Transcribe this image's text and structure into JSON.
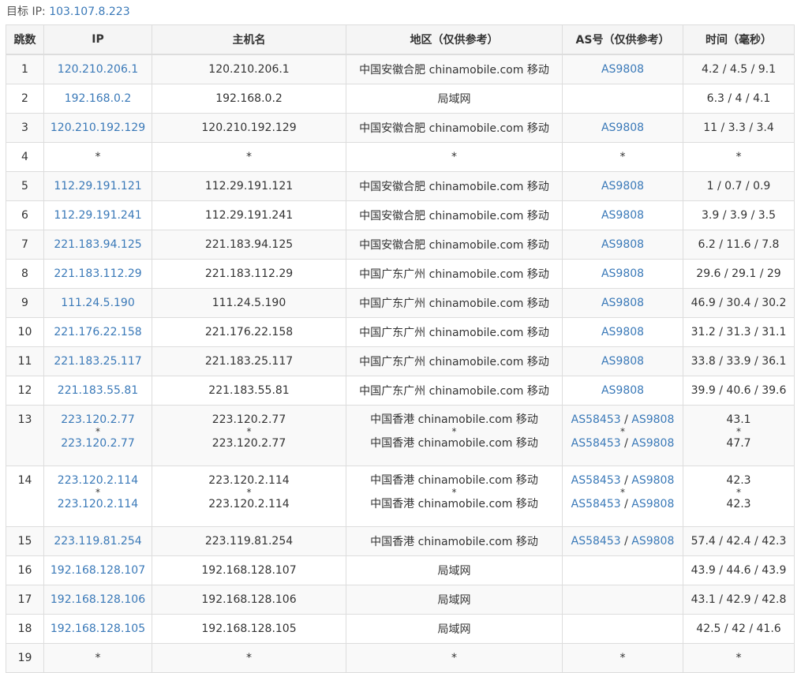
{
  "target": {
    "label": "目标 IP:",
    "ip": "103.107.8.223"
  },
  "headers": [
    "跳数",
    "IP",
    "主机名",
    "地区（仅供参考）",
    "AS号（仅供参考）",
    "时间（毫秒）"
  ],
  "rows": [
    {
      "hop": "1",
      "ip": "120.210.206.1",
      "host": "120.210.206.1",
      "region": "中国安徽合肥 chinamobile.com 移动",
      "as": "AS9808",
      "time": "4.2 / 4.5 / 9.1"
    },
    {
      "hop": "2",
      "ip": "192.168.0.2",
      "host": "192.168.0.2",
      "region": "局域网",
      "as": "",
      "time": "6.3 / 4 / 4.1"
    },
    {
      "hop": "3",
      "ip": "120.210.192.129",
      "host": "120.210.192.129",
      "region": "中国安徽合肥 chinamobile.com 移动",
      "as": "AS9808",
      "time": "11 / 3.3 / 3.4"
    },
    {
      "hop": "4",
      "ip": "*",
      "host": "*",
      "region": "*",
      "as": "*",
      "time": "*"
    },
    {
      "hop": "5",
      "ip": "112.29.191.121",
      "host": "112.29.191.121",
      "region": "中国安徽合肥 chinamobile.com 移动",
      "as": "AS9808",
      "time": "1 / 0.7 / 0.9"
    },
    {
      "hop": "6",
      "ip": "112.29.191.241",
      "host": "112.29.191.241",
      "region": "中国安徽合肥 chinamobile.com 移动",
      "as": "AS9808",
      "time": "3.9 / 3.9 / 3.5"
    },
    {
      "hop": "7",
      "ip": "221.183.94.125",
      "host": "221.183.94.125",
      "region": "中国安徽合肥 chinamobile.com 移动",
      "as": "AS9808",
      "time": "6.2 / 11.6 / 7.8"
    },
    {
      "hop": "8",
      "ip": "221.183.112.29",
      "host": "221.183.112.29",
      "region": "中国广东广州 chinamobile.com 移动",
      "as": "AS9808",
      "time": "29.6 / 29.1 / 29"
    },
    {
      "hop": "9",
      "ip": "111.24.5.190",
      "host": "111.24.5.190",
      "region": "中国广东广州 chinamobile.com 移动",
      "as": "AS9808",
      "time": "46.9 / 30.4 / 30.2"
    },
    {
      "hop": "10",
      "ip": "221.176.22.158",
      "host": "221.176.22.158",
      "region": "中国广东广州 chinamobile.com 移动",
      "as": "AS9808",
      "time": "31.2 / 31.3 / 31.1"
    },
    {
      "hop": "11",
      "ip": "221.183.25.117",
      "host": "221.183.25.117",
      "region": "中国广东广州 chinamobile.com 移动",
      "as": "AS9808",
      "time": "33.8 / 33.9 / 36.1"
    },
    {
      "hop": "12",
      "ip": "221.183.55.81",
      "host": "221.183.55.81",
      "region": "中国广东广州 chinamobile.com 移动",
      "as": "AS9808",
      "time": "39.9 / 40.6 / 39.6"
    },
    {
      "hop": "13",
      "ip": "223.120.2.77",
      "host": "223.120.2.77",
      "region": "中国香港 chinamobile.com 移动",
      "as_a": "AS58453",
      "as_b": "AS9808",
      "time": "43.1",
      "ip2": "223.120.2.77",
      "host2": "223.120.2.77",
      "region2": "中国香港 chinamobile.com 移动",
      "as2_a": "AS58453",
      "as2_b": "AS9808",
      "time2": "47.7",
      "star": "*"
    },
    {
      "hop": "14",
      "ip": "223.120.2.114",
      "host": "223.120.2.114",
      "region": "中国香港 chinamobile.com 移动",
      "as_a": "AS58453",
      "as_b": "AS9808",
      "time": "42.3",
      "ip2": "223.120.2.114",
      "host2": "223.120.2.114",
      "region2": "中国香港 chinamobile.com 移动",
      "as2_a": "AS58453",
      "as2_b": "AS9808",
      "time2": "42.3",
      "star": "*"
    },
    {
      "hop": "15",
      "ip": "223.119.81.254",
      "host": "223.119.81.254",
      "region": "中国香港 chinamobile.com 移动",
      "as_a": "AS58453",
      "as_b": "AS9808",
      "time": "57.4 / 42.4 / 42.3"
    },
    {
      "hop": "16",
      "ip": "192.168.128.107",
      "host": "192.168.128.107",
      "region": "局域网",
      "as": "",
      "time": "43.9 / 44.6 / 43.9"
    },
    {
      "hop": "17",
      "ip": "192.168.128.106",
      "host": "192.168.128.106",
      "region": "局域网",
      "as": "",
      "time": "43.1 / 42.9 / 42.8"
    },
    {
      "hop": "18",
      "ip": "192.168.128.105",
      "host": "192.168.128.105",
      "region": "局域网",
      "as": "",
      "time": "42.5 / 42 / 41.6"
    },
    {
      "hop": "19",
      "ip": "*",
      "host": "*",
      "region": "*",
      "as": "*",
      "time": "*"
    }
  ],
  "as_separator": " / ",
  "colors": {
    "link": "#3a79b8",
    "header_bg": "#f5f5f5",
    "stripe_bg": "#f9f9f9",
    "border": "#dddddd"
  }
}
